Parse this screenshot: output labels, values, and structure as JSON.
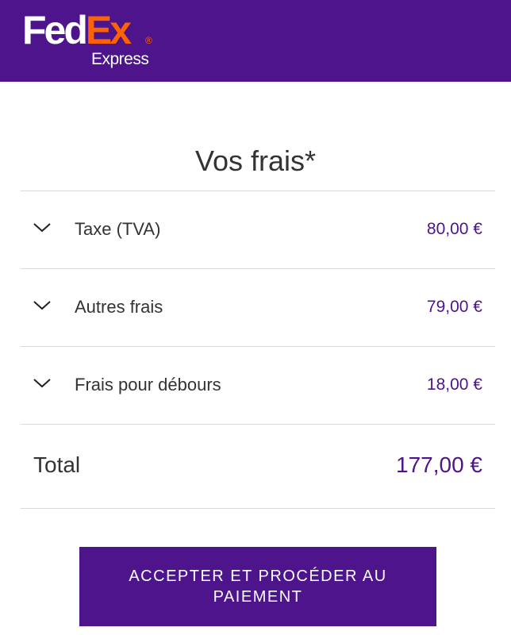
{
  "header": {
    "logo": {
      "fed": "Fed",
      "ex": "Ex",
      "reg": "®",
      "express": "Express",
      "colors": {
        "background": "#4d148c",
        "fed": "#ffffff",
        "ex": "#ff6200"
      }
    }
  },
  "title": "Vos frais*",
  "fees": [
    {
      "label": "Taxe (TVA)",
      "amount": "80,00 €",
      "icon": "chevron-down-icon"
    },
    {
      "label": "Autres frais",
      "amount": "79,00 €",
      "icon": "chevron-down-icon"
    },
    {
      "label": "Frais pour débours",
      "amount": "18,00 €",
      "icon": "chevron-down-icon"
    }
  ],
  "total": {
    "label": "Total",
    "amount": "177,00 €"
  },
  "button": {
    "label": "ACCEPTER ET PROCÉDER AU PAIEMENT"
  },
  "colors": {
    "accent": "#4d148c",
    "text": "#333333",
    "divider": "#d9d9d9"
  }
}
